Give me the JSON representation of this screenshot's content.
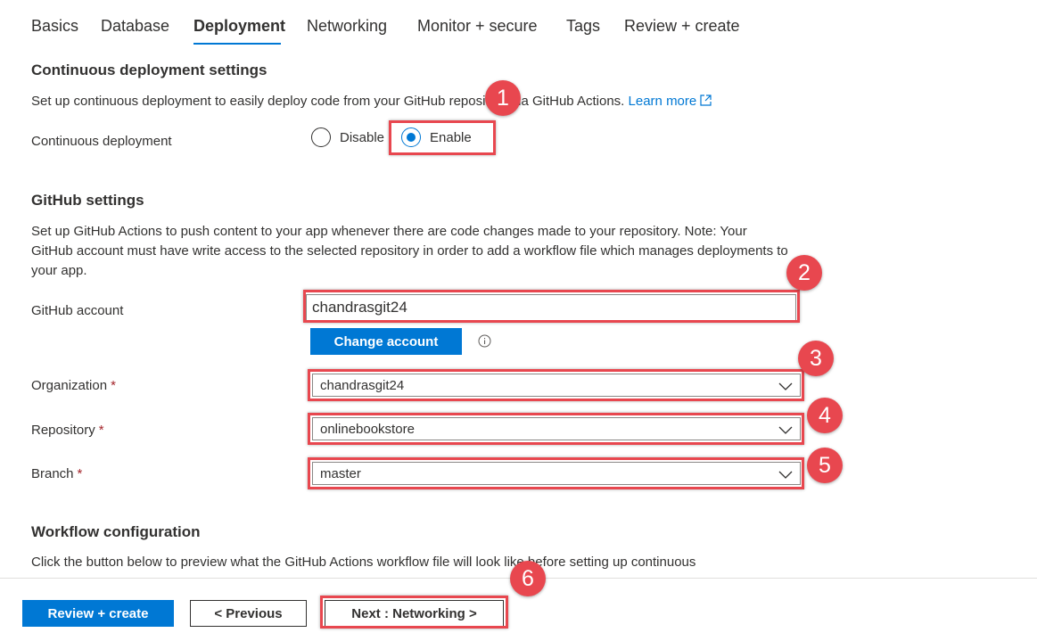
{
  "tabs": [
    {
      "label": "Basics"
    },
    {
      "label": "Database"
    },
    {
      "label": "Deployment"
    },
    {
      "label": "Networking"
    },
    {
      "label": "Monitor + secure"
    },
    {
      "label": "Tags"
    },
    {
      "label": "Review + create"
    }
  ],
  "active_tab": "Deployment",
  "cd": {
    "title": "Continuous deployment settings",
    "description": "Set up continuous deployment to easily deploy code from your GitHub repository via GitHub Actions.",
    "learn_more": "Learn more",
    "label": "Continuous deployment",
    "options": [
      "Disable",
      "Enable"
    ],
    "selected": "Enable"
  },
  "github": {
    "title": "GitHub settings",
    "description": "Set up GitHub Actions to push content to your app whenever there are code changes made to your repository. Note: Your GitHub account must have write access to the selected repository in order to add a workflow file which manages deployments to your app.",
    "account_label": "GitHub account",
    "account_value": "chandrasgit24",
    "change_account": "Change account",
    "org_label": "Organization",
    "org_value": "chandrasgit24",
    "repo_label": "Repository",
    "repo_value": "onlinebookstore",
    "branch_label": "Branch",
    "branch_value": "master",
    "required_mark": "*"
  },
  "workflow": {
    "title": "Workflow configuration",
    "description": "Click the button below to preview what the GitHub Actions workflow file will look like before setting up continuous"
  },
  "footer": {
    "review_create": "Review + create",
    "previous": "< Previous",
    "next": "Next : Networking >"
  },
  "badges": [
    "1",
    "2",
    "3",
    "4",
    "5",
    "6"
  ],
  "colors": {
    "accent": "#0078d4",
    "highlight": "#e8474f",
    "required": "#a4262c"
  }
}
